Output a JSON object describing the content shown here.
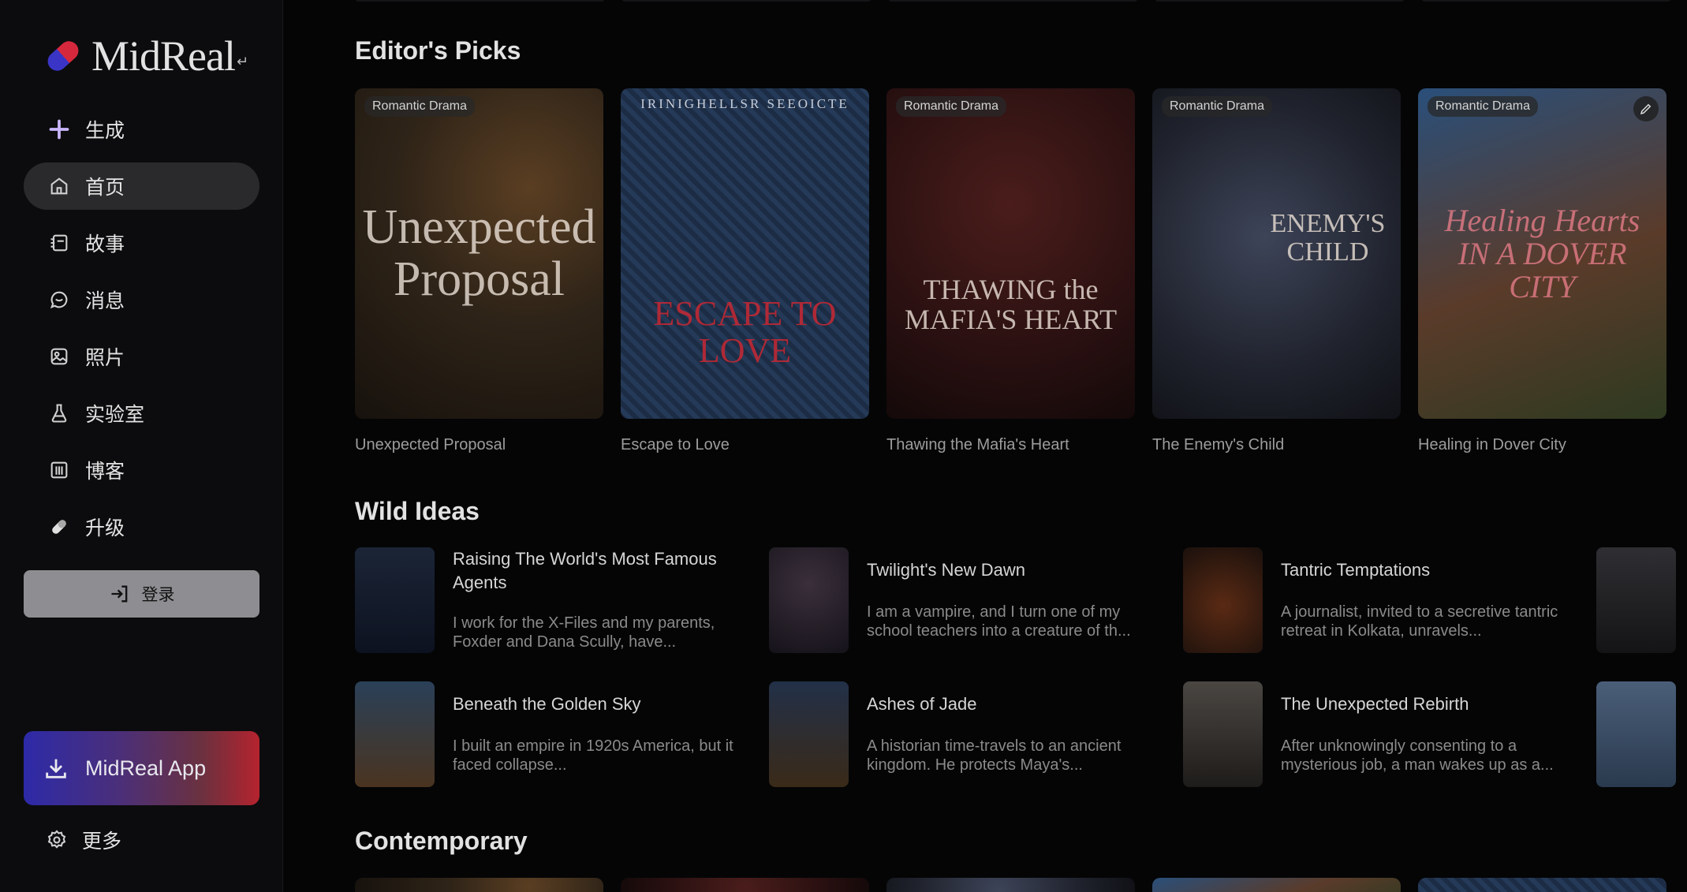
{
  "sidebar": {
    "logo": {
      "text": "MidReal",
      "sup": "↵"
    },
    "items": [
      {
        "label": "生成",
        "icon": "plus-icon"
      },
      {
        "label": "首页",
        "icon": "home-icon"
      },
      {
        "label": "故事",
        "icon": "story-icon"
      },
      {
        "label": "消息",
        "icon": "message-icon"
      },
      {
        "label": "照片",
        "icon": "photo-icon"
      },
      {
        "label": "实验室",
        "icon": "flask-icon"
      },
      {
        "label": "博客",
        "icon": "blog-icon"
      },
      {
        "label": "升级",
        "icon": "pill-icon"
      }
    ],
    "login_label": "登录",
    "app_label": "MidReal App",
    "more_label": "更多"
  },
  "editors_picks": {
    "heading": "Editor's Picks",
    "cards": [
      {
        "title": "Unexpected Proposal",
        "badge": "Romantic Drama",
        "cover_text": "Unexpected Proposal"
      },
      {
        "title": "Escape to Love",
        "badge": "",
        "cover_top": "IRINIGHELLSR SEEOICTE",
        "cover_text": "ESCAPE TO LOVE"
      },
      {
        "title": "Thawing the Mafia's Heart",
        "badge": "Romantic Drama",
        "cover_text": "THAWING the MAFIA'S HEART"
      },
      {
        "title": "The Enemy's Child",
        "badge": "Romantic Drama",
        "cover_text": "ENEMY'S CHILD"
      },
      {
        "title": "Healing in Dover City",
        "badge": "Romantic Drama",
        "cover_text": "Healing Hearts IN A DOVER CITY"
      }
    ]
  },
  "wild_ideas": {
    "heading": "Wild Ideas",
    "items": [
      {
        "title": "Raising The World's Most Famous Agents",
        "desc": "I work for the X-Files and my parents, Foxder and Dana Scully, have..."
      },
      {
        "title": "Twilight's New Dawn",
        "desc": "I am a vampire, and I turn one of my school teachers into a creature of th..."
      },
      {
        "title": "Tantric Temptations",
        "desc": "A journalist, invited to a secretive tantric retreat in Kolkata, unravels..."
      },
      {
        "title": "Beneath the Golden Sky",
        "desc": "I built an empire in 1920s America, but it faced collapse..."
      },
      {
        "title": "Ashes of Jade",
        "desc": "A historian time-travels to an ancient kingdom. He protects Maya's..."
      },
      {
        "title": "The Unexpected Rebirth",
        "desc": "After unknowingly consenting to a mysterious job, a man wakes up as a..."
      }
    ]
  },
  "contemporary": {
    "heading": "Contemporary"
  }
}
